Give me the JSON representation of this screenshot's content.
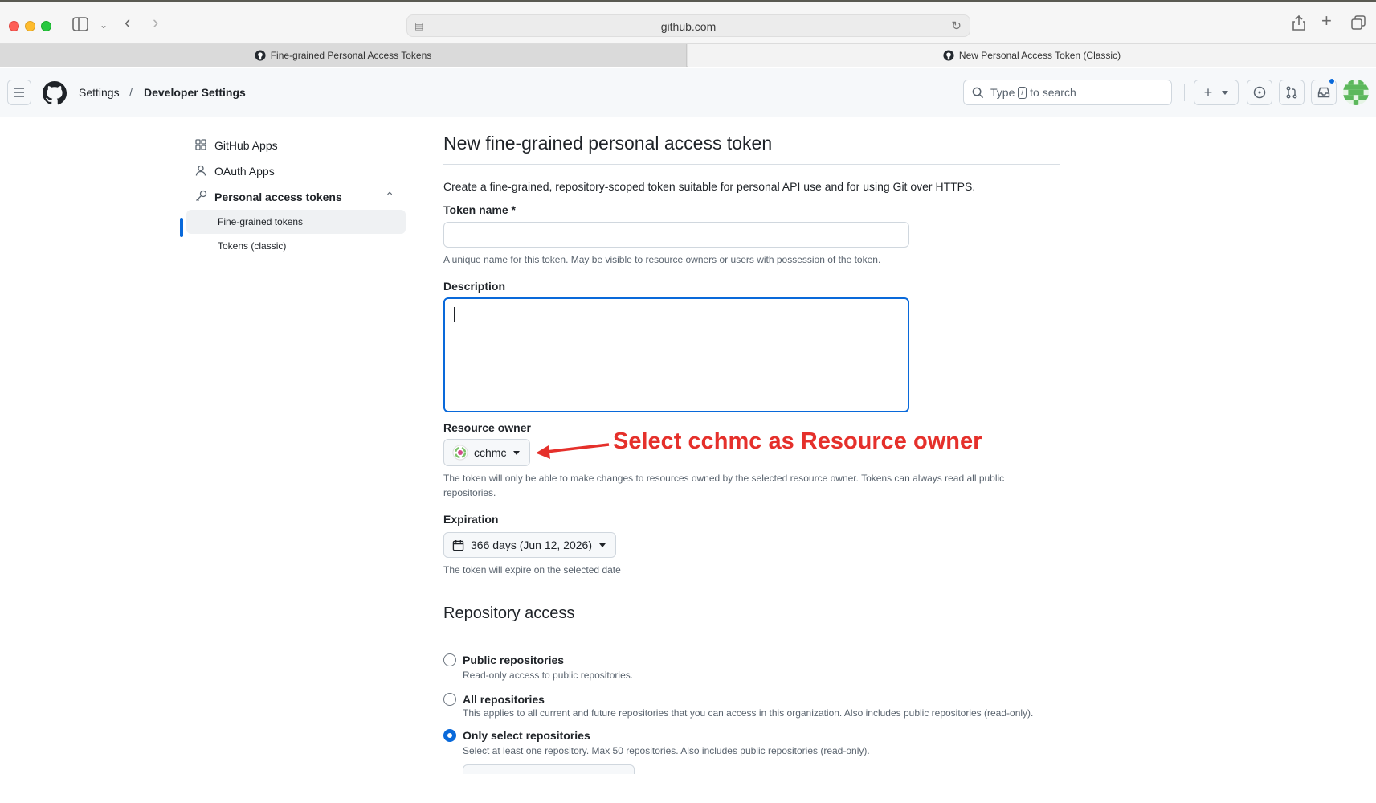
{
  "browser": {
    "url": "github.com",
    "tabs": [
      {
        "label": "Fine-grained Personal Access Tokens"
      },
      {
        "label": "New Personal Access Token (Classic)"
      }
    ]
  },
  "header": {
    "breadcrumb": [
      "Settings",
      "Developer Settings"
    ],
    "separator": "/",
    "search_prefix": "Type",
    "search_key": "/",
    "search_suffix": "to search"
  },
  "sidebar": {
    "items": [
      {
        "label": "GitHub Apps",
        "icon": "apps-icon"
      },
      {
        "label": "OAuth Apps",
        "icon": "person-icon"
      },
      {
        "label": "Personal access tokens",
        "icon": "key-icon"
      }
    ],
    "subitems": [
      {
        "label": "Fine-grained tokens"
      },
      {
        "label": "Tokens (classic)"
      }
    ]
  },
  "form": {
    "title": "New fine-grained personal access token",
    "intro": "Create a fine-grained, repository-scoped token suitable for personal API use and for using Git over HTTPS.",
    "token_name_label": "Token name *",
    "token_name_value": "",
    "token_name_note": "A unique name for this token. May be visible to resource owners or users with possession of the token.",
    "description_label": "Description",
    "description_value": "",
    "owner_label": "Resource owner",
    "owner_value": "cchmc",
    "owner_note": "The token will only be able to make changes to resources owned by the selected resource owner. Tokens can always read all public repositories.",
    "expiration_label": "Expiration",
    "expiration_value": "366 days (Jun 12, 2026)",
    "expiration_note": "The token will expire on the selected date"
  },
  "repo_access": {
    "title": "Repository access",
    "options": [
      {
        "label": "Public repositories",
        "note": "Read-only access to public repositories.",
        "selected": false
      },
      {
        "label": "All repositories",
        "note": "This applies to all current and future repositories that you can access in this organization. Also includes public repositories (read-only).",
        "selected": false
      },
      {
        "label": "Only select repositories",
        "note": "Select at least one repository. Max 50 repositories. Also includes public repositories (read-only).",
        "selected": true
      }
    ]
  },
  "annotation": {
    "text": "Select cchmc as Resource owner",
    "color": "#e5302b"
  },
  "colors": {
    "accent": "#0969da"
  }
}
